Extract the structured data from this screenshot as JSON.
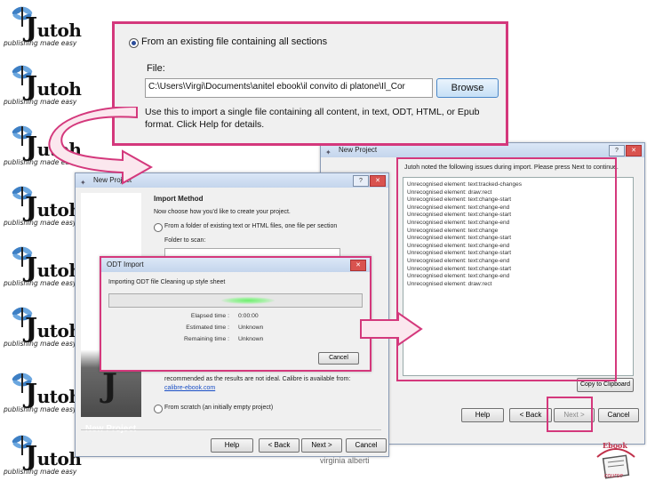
{
  "logos": {
    "word": "utoh",
    "big_letter": "J",
    "tagline": "publishing made easy"
  },
  "zoom_box": {
    "radio_label": "From an existing file containing all sections",
    "file_label": "File:",
    "file_value": "C:\\Users\\Virgi\\Documents\\anitel ebook\\il convito di platone\\Il_Cor",
    "browse_label": "Browse",
    "help_text": "Use this to import a single file containing all content, in text, ODT, HTML, or Epub format. Click Help for details."
  },
  "left_window": {
    "title": "New Project",
    "heading": "Import Method",
    "subheading": "Now choose how you'd like to create your project.",
    "option_folder": "From a folder of existing text or HTML files, one file per section",
    "folder_label": "Folder to scan:",
    "calibre_text": "recommended as the results are not ideal. Calibre is available from:",
    "calibre_link": "calibre-ebook.com",
    "option_scratch": "From scratch (an initially empty project)",
    "side_label": "New Project",
    "buttons": [
      "Help",
      "< Back",
      "Next >",
      "Cancel"
    ]
  },
  "odt_dialog": {
    "title": "ODT Import",
    "status": "Importing ODT file Cleaning up style sheet",
    "progress": 0.55,
    "rows": [
      {
        "label": "Elapsed time :",
        "value": "0:00:00"
      },
      {
        "label": "Estimated time :",
        "value": "Unknown"
      },
      {
        "label": "Remaining time :",
        "value": "Unknown"
      }
    ],
    "cancel_label": "Cancel"
  },
  "right_window": {
    "title": "New Project",
    "notice": "Jutoh noted the following issues during import. Please press Next to continue.",
    "issues": [
      "Unrecognised element: text:tracked-changes",
      "Unrecognised element: draw:rect",
      "Unrecognised element: text:change-start",
      "Unrecognised element: text:change-end",
      "Unrecognised element: text:change-start",
      "Unrecognised element: text:change-end",
      "Unrecognised element: text:change",
      "Unrecognised element: text:change-start",
      "Unrecognised element: text:change-end",
      "Unrecognised element: text:change-start",
      "Unrecognised element: text:change-end",
      "Unrecognised element: text:change-start",
      "Unrecognised element: text:change-end",
      "Unrecognised element: draw:rect"
    ],
    "copy_label": "Copy to Clipboard",
    "buttons": [
      "Help",
      "< Back",
      "Next >",
      "Cancel"
    ]
  },
  "footer": {
    "author": "virginia alberti"
  },
  "badge": {
    "top": "Ebook",
    "bottom": "course"
  },
  "colors": {
    "highlight": "#d4387c",
    "arrow_fill": "#fbe7ee",
    "title_bar": "#c4d5ec"
  }
}
